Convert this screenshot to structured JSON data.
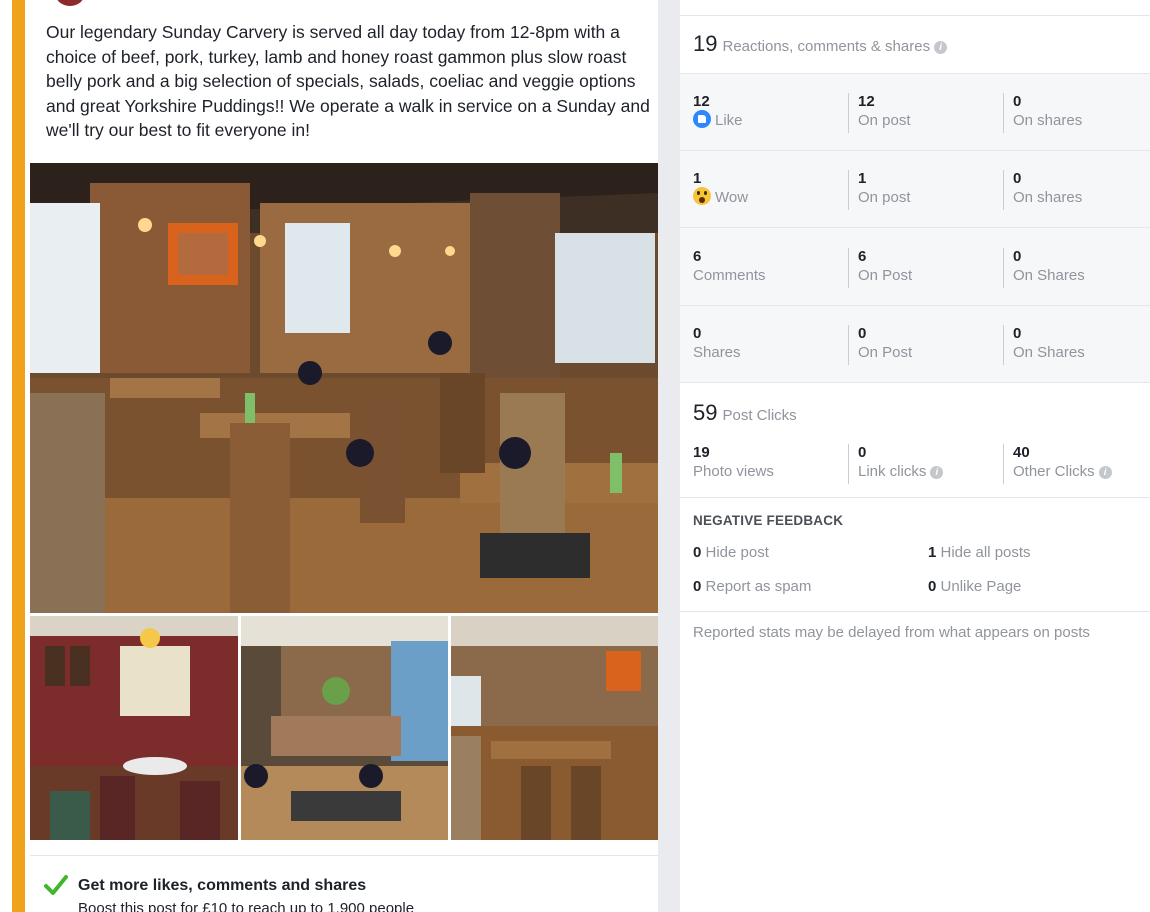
{
  "post": {
    "text": "Our legendary Sunday Carvery is served all day today from 12-8pm with a choice of beef, pork, turkey, lamb and honey roast gammon plus slow roast belly pork and a big selection of specials, salads, coeliac and veggie options and great Yorkshire Puddings!! We operate a walk in service on a Sunday and we'll try our best to fit everyone in!",
    "accent_color": "#f0a31a"
  },
  "boost": {
    "title": "Get more likes, comments and shares",
    "subtitle": "Boost this post for £10 to reach up to 1,900 people"
  },
  "stats": {
    "reactions_header": {
      "count": "19",
      "label": "Reactions, comments & shares"
    },
    "rows": [
      {
        "total": "12",
        "total_label": "Like",
        "icon": "like-icon",
        "on_post": "12",
        "on_post_label": "On post",
        "on_shares": "0",
        "on_shares_label": "On shares"
      },
      {
        "total": "1",
        "total_label": "Wow",
        "icon": "wow-icon",
        "on_post": "1",
        "on_post_label": "On post",
        "on_shares": "0",
        "on_shares_label": "On shares"
      },
      {
        "total": "6",
        "total_label": "Comments",
        "on_post": "6",
        "on_post_label": "On Post",
        "on_shares": "0",
        "on_shares_label": "On Shares"
      },
      {
        "total": "0",
        "total_label": "Shares",
        "on_post": "0",
        "on_post_label": "On Post",
        "on_shares": "0",
        "on_shares_label": "On Shares"
      }
    ],
    "post_clicks": {
      "count": "59",
      "label": "Post Clicks",
      "photo_views": "19",
      "photo_views_label": "Photo views",
      "link_clicks": "0",
      "link_clicks_label": "Link clicks",
      "other_clicks": "40",
      "other_clicks_label": "Other Clicks"
    },
    "negative_feedback": {
      "title": "NEGATIVE FEEDBACK",
      "hide_post": "0",
      "hide_post_label": "Hide post",
      "hide_all": "1",
      "hide_all_label": "Hide all posts",
      "report_spam": "0",
      "report_spam_label": "Report as spam",
      "unlike_page": "0",
      "unlike_page_label": "Unlike Page"
    },
    "footnote": "Reported stats may be delayed from what appears on posts"
  }
}
